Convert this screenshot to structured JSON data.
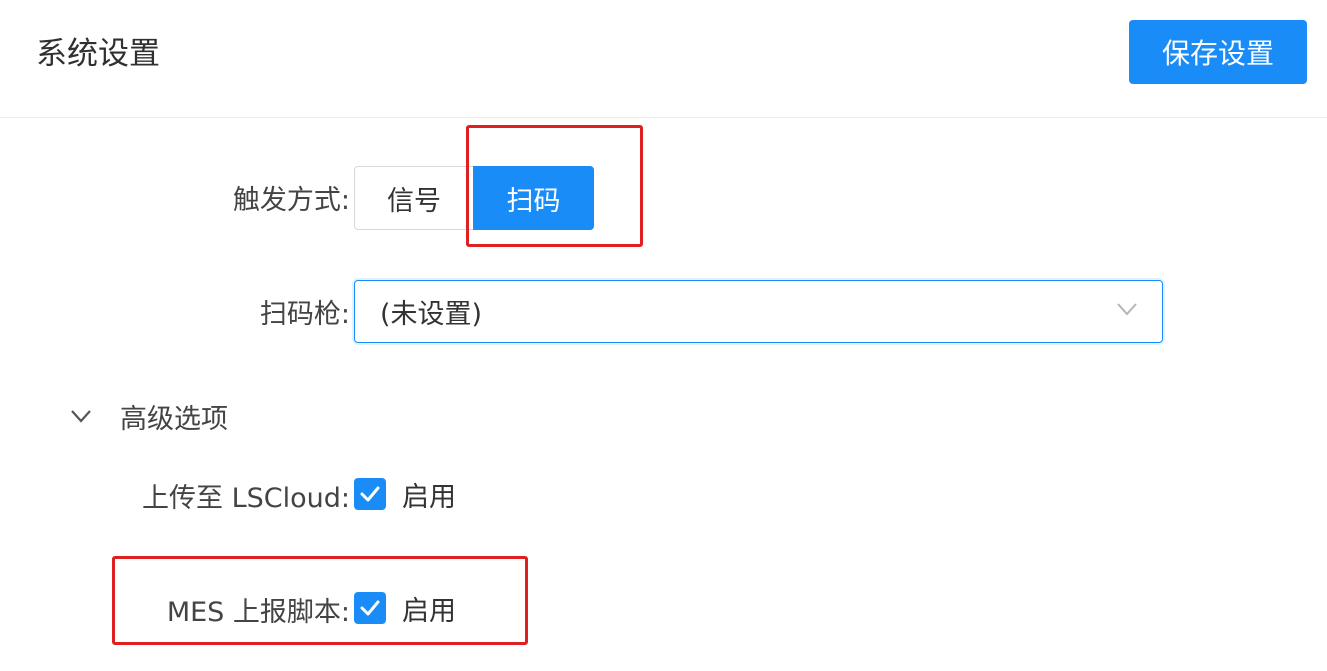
{
  "header": {
    "title": "系统设置",
    "save_label": "保存设置"
  },
  "form": {
    "trigger": {
      "label": "触发方式:",
      "options": [
        "信号",
        "扫码"
      ],
      "selected": "扫码"
    },
    "scanner": {
      "label": "扫码枪:",
      "value": "(未设置)"
    },
    "advanced": {
      "label": "高级选项",
      "expanded": true,
      "lscloud": {
        "label": "上传至 LSCloud:",
        "checked": true,
        "text": "启用"
      },
      "mes": {
        "label": "MES 上报脚本:",
        "checked": true,
        "text": "启用"
      }
    }
  },
  "colors": {
    "accent": "#1a8cf7",
    "annotation": "#e02020"
  },
  "icons": {
    "select_arrow": "chevron-down-icon",
    "collapse": "chevron-down-icon",
    "check": "check-icon"
  }
}
